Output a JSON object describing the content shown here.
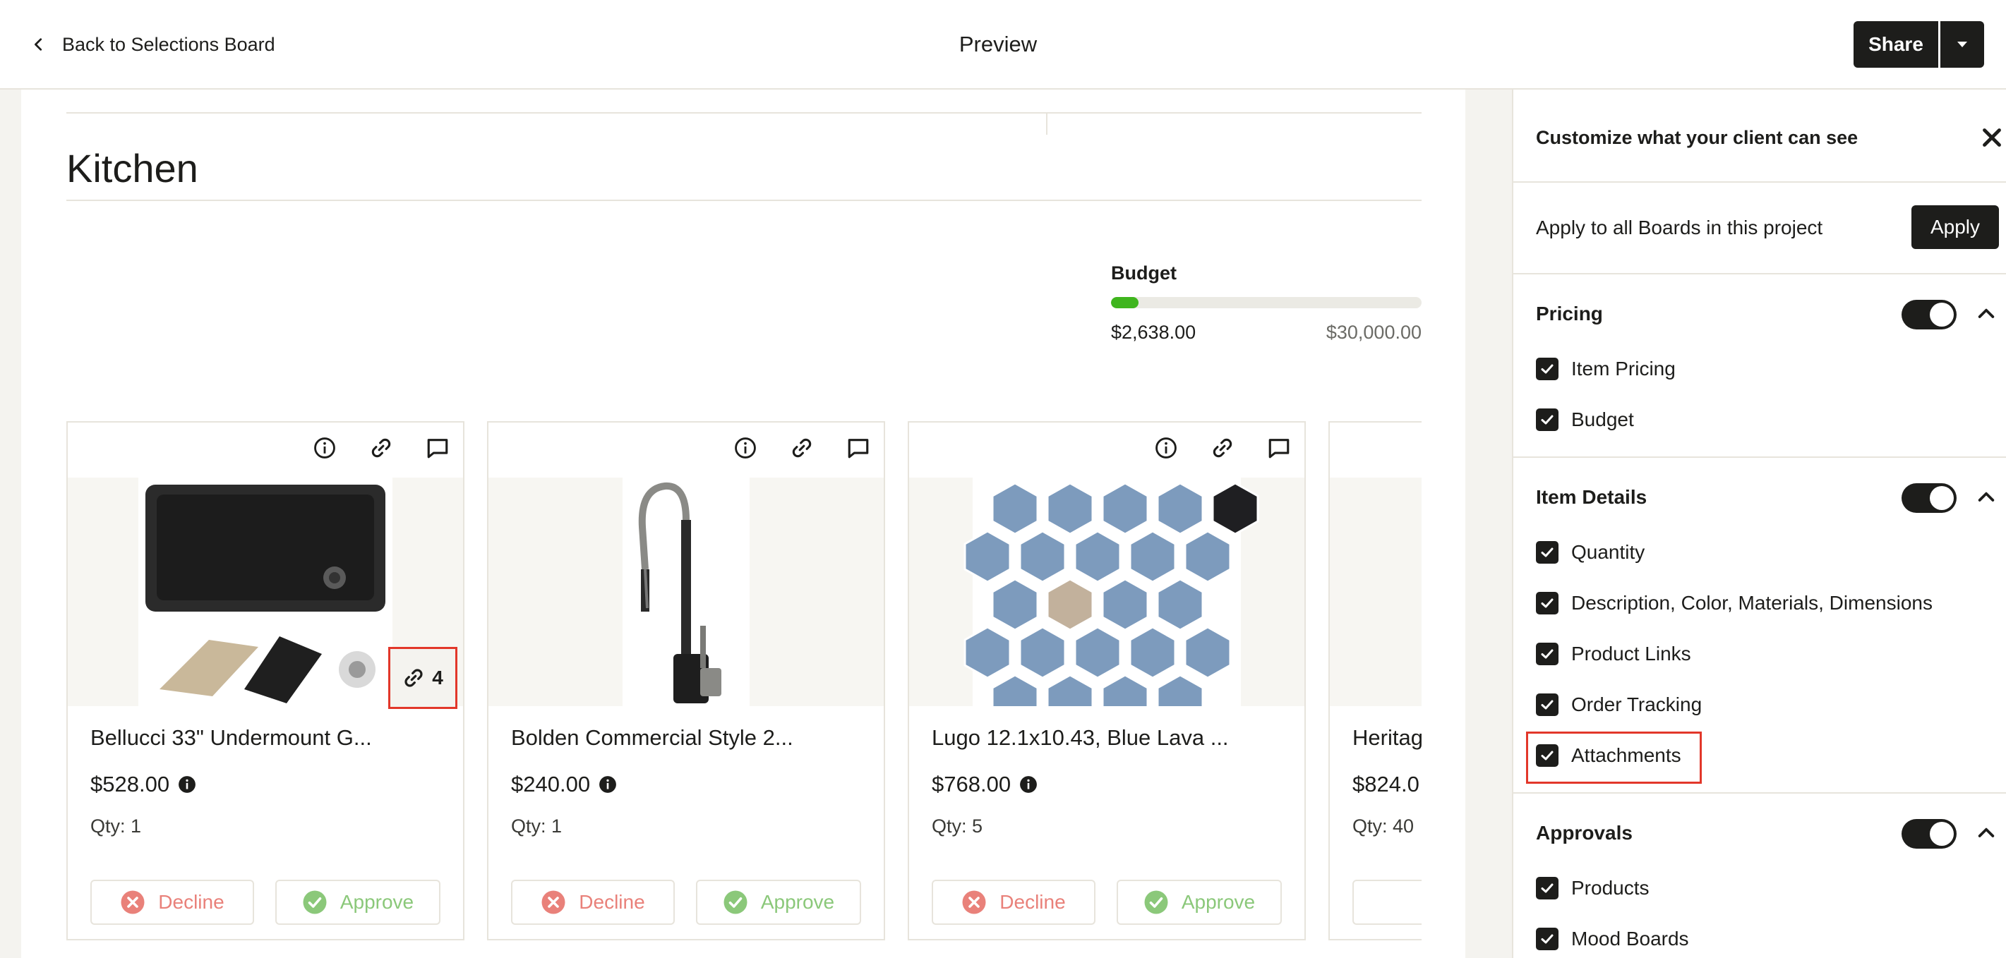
{
  "topbar": {
    "back_label": "Back to Selections Board",
    "title": "Preview",
    "share_label": "Share"
  },
  "board": {
    "room_title": "Kitchen",
    "budget": {
      "label": "Budget",
      "spent": "$2,638.00",
      "total": "$30,000.00",
      "fill_fraction": 0.088,
      "fill_color": "#3fb51e"
    }
  },
  "cards": [
    {
      "name": "Bellucci 33\" Undermount G...",
      "price": "$528.00",
      "qty": "Qty: 1",
      "decline_label": "Decline",
      "approve_label": "Approve",
      "attachment_count": "4"
    },
    {
      "name": "Bolden Commercial Style 2...",
      "price": "$240.00",
      "qty": "Qty: 1",
      "decline_label": "Decline",
      "approve_label": "Approve"
    },
    {
      "name": "Lugo 12.1x10.43, Blue Lava ...",
      "price": "$768.00",
      "qty": "Qty: 5",
      "decline_label": "Decline",
      "approve_label": "Approve"
    },
    {
      "name": "Heritag",
      "price": "$824.0",
      "qty": "Qty: 40",
      "decline_label": "",
      "approve_label": ""
    }
  ],
  "panel": {
    "title": "Customize what your client can see",
    "apply_text": "Apply to all Boards in this project",
    "apply_label": "Apply",
    "sections": [
      {
        "title": "Pricing",
        "enabled": true,
        "options": [
          "Item Pricing",
          "Budget"
        ]
      },
      {
        "title": "Item Details",
        "enabled": true,
        "options": [
          "Quantity",
          "Description, Color, Materials, Dimensions",
          "Product Links",
          "Order Tracking",
          "Attachments"
        ]
      },
      {
        "title": "Approvals",
        "enabled": true,
        "options": [
          "Products",
          "Mood Boards"
        ]
      }
    ]
  },
  "colors": {
    "accent_dark": "#1d1d1b",
    "decline": "#e9817a",
    "approve": "#8bc87a",
    "highlight_box": "#e2372a",
    "budget_fill": "#3fb51e"
  },
  "icons": [
    "chevron-left-icon",
    "caret-down-icon",
    "info-icon",
    "link-icon",
    "comment-icon",
    "close-icon",
    "chevron-up-icon",
    "check-icon",
    "x-circle-icon",
    "check-circle-icon",
    "paperclip-icon"
  ]
}
